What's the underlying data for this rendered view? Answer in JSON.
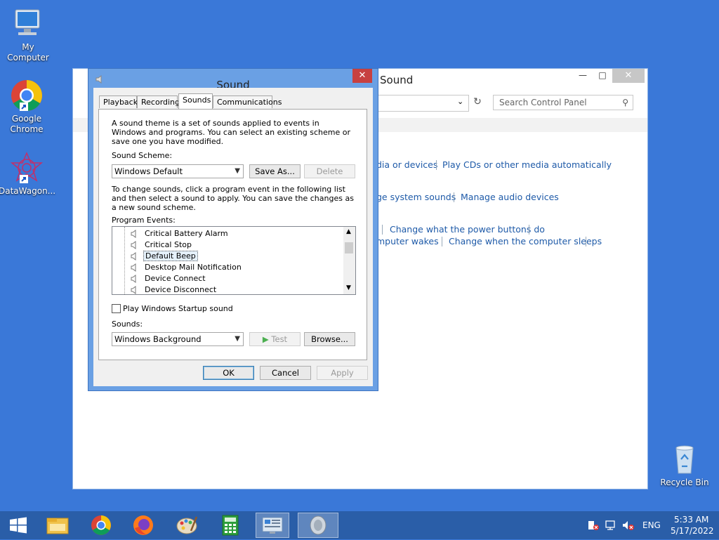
{
  "desktop": {
    "icons": [
      {
        "label": "My Computer",
        "icon": "computer-icon"
      },
      {
        "label": "Google\nChrome",
        "icon": "chrome-icon"
      },
      {
        "label": "DataWagon...",
        "icon": "datawagon-icon"
      },
      {
        "label": "Recycle Bin",
        "icon": "recycle-bin-icon"
      }
    ]
  },
  "control_panel": {
    "title": "Sound",
    "search_placeholder": "Search Control Panel",
    "links": {
      "row1": [
        "dia or devices",
        "Play CDs or other media automatically"
      ],
      "row2": [
        "ge system sounds",
        "Manage audio devices"
      ],
      "row3": [
        "Change what the power buttons do"
      ],
      "row4": [
        "mputer wakes",
        "Change when the computer sleeps"
      ]
    }
  },
  "dialog": {
    "title": "Sound",
    "tabs": [
      "Playback",
      "Recording",
      "Sounds",
      "Communications"
    ],
    "active_tab": "Sounds",
    "intro": "A sound theme is a set of sounds applied to events in Windows and programs.  You can select an existing scheme or save one you have modified.",
    "scheme_label": "Sound Scheme:",
    "scheme_value": "Windows Default",
    "save_as": "Save As...",
    "delete": "Delete",
    "change_text": "To change sounds, click a program event in the following list and then select a sound to apply.  You can save the changes as a new sound scheme.",
    "events_label": "Program Events:",
    "events": [
      "Critical Battery Alarm",
      "Critical Stop",
      "Default Beep",
      "Desktop Mail Notification",
      "Device Connect",
      "Device Disconnect"
    ],
    "selected_event": "Default Beep",
    "startup_checkbox": "Play Windows Startup sound",
    "startup_checked": false,
    "sounds_label": "Sounds:",
    "sound_value": "Windows Background",
    "test": "Test",
    "browse": "Browse...",
    "ok": "OK",
    "cancel": "Cancel",
    "apply": "Apply"
  },
  "taskbar": {
    "apps": [
      "start-icon",
      "file-explorer-icon",
      "chrome-icon",
      "firefox-icon",
      "paint-icon",
      "calculator-icon",
      "control-panel-icon",
      "sound-icon"
    ],
    "language": "ENG",
    "time": "5:33 AM",
    "date": "5/17/2022"
  }
}
